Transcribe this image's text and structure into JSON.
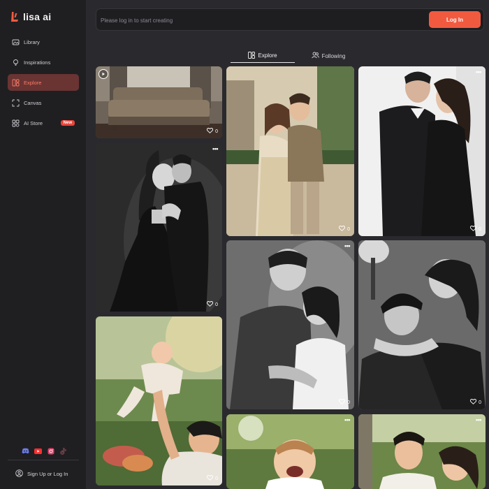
{
  "app": {
    "logo_text": "lisa ai",
    "brand_color": "#f25a40"
  },
  "sidebar": {
    "items": [
      {
        "label": "Library",
        "icon": "library-icon"
      },
      {
        "label": "Inspirations",
        "icon": "lightbulb-icon"
      },
      {
        "label": "Explore",
        "icon": "explore-icon",
        "active": true
      },
      {
        "label": "Canvas",
        "icon": "canvas-icon"
      },
      {
        "label": "AI Store",
        "icon": "store-icon",
        "badge": "New"
      }
    ],
    "socials": [
      "discord-icon",
      "youtube-icon",
      "instagram-icon",
      "tiktok-icon"
    ],
    "signup_label": "Sign Up or Log In"
  },
  "search": {
    "placeholder": "Please log in to start creating",
    "value": ""
  },
  "header": {
    "login_label": "Log In"
  },
  "tabs": [
    {
      "label": "Explore",
      "icon": "grid-icon",
      "active": true
    },
    {
      "label": "Following",
      "icon": "users-icon",
      "active": false
    }
  ],
  "cards": [
    {
      "subject": "sofa in room",
      "likes": "0",
      "video": true
    },
    {
      "subject": "couple black and white",
      "likes": "0"
    },
    {
      "subject": "baby lifted outdoors",
      "likes": "0"
    },
    {
      "subject": "couple walking street",
      "likes": "0"
    },
    {
      "subject": "couple smiling black and white",
      "likes": "0"
    },
    {
      "subject": "laughing baby",
      "likes": ""
    },
    {
      "subject": "couple studio kiss",
      "likes": "0"
    },
    {
      "subject": "couple studio light",
      "likes": "0"
    },
    {
      "subject": "smiling couple outdoors",
      "likes": ""
    }
  ]
}
